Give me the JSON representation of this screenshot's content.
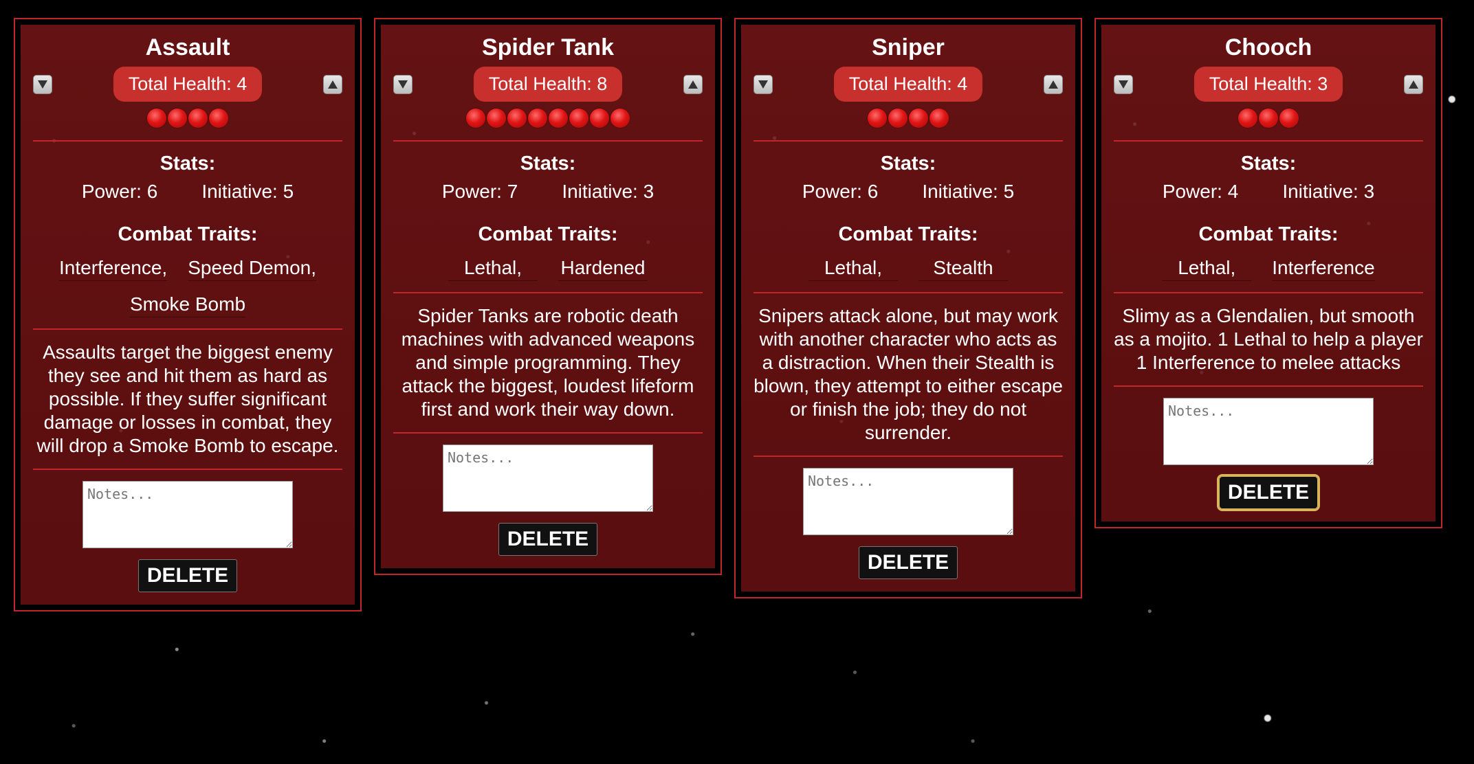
{
  "labels": {
    "health_prefix": "Total Health: ",
    "stats_heading": "Stats:",
    "power_prefix": "Power: ",
    "initiative_prefix": "Initiative: ",
    "traits_heading": "Combat Traits:",
    "notes_placeholder": "Notes...",
    "delete_label": "DELETE"
  },
  "icons": {
    "decrease": "triangle-down-icon",
    "increase": "triangle-up-icon",
    "health_pip": "red-orb-icon"
  },
  "colors": {
    "card_bg": "#5e0f10",
    "card_border": "#c0262a",
    "health_pill": "#c8302e",
    "pip": "#e01515",
    "focus_outline": "#d9b45a"
  },
  "cards": [
    {
      "name": "Assault",
      "total_health": 4,
      "health_text": "Total Health: 4",
      "power_text": "Power: 6",
      "initiative_text": "Initiative: 5",
      "traits": [
        "Interference,",
        "Speed Demon,",
        "Smoke Bomb"
      ],
      "description": "Assaults target the biggest enemy they see and hit them as hard as possible. If they suffer significant damage or losses in combat, they will drop a Smoke Bomb to escape.",
      "notes_value": "",
      "delete_focused": false
    },
    {
      "name": "Spider Tank",
      "total_health": 8,
      "health_text": "Total Health: 8",
      "power_text": "Power: 7",
      "initiative_text": "Initiative: 3",
      "traits": [
        "Lethal,",
        "Hardened"
      ],
      "description": "Spider Tanks are robotic death machines with advanced weapons and simple programming. They attack the biggest, loudest lifeform first and work their way down.",
      "notes_value": "",
      "delete_focused": false
    },
    {
      "name": "Sniper",
      "total_health": 4,
      "health_text": "Total Health: 4",
      "power_text": "Power: 6",
      "initiative_text": "Initiative: 5",
      "traits": [
        "Lethal,",
        "Stealth"
      ],
      "description": "Snipers attack alone, but may work with another character who acts as a distraction. When their Stealth is blown, they attempt to either escape or finish the job; they do not surrender.",
      "notes_value": "",
      "delete_focused": false
    },
    {
      "name": "Chooch",
      "total_health": 3,
      "health_text": "Total Health: 3",
      "power_text": "Power: 4",
      "initiative_text": "Initiative: 3",
      "traits": [
        "Lethal,",
        "Interference"
      ],
      "description": "Slimy as a Glendalien, but smooth as a mojito. 1 Lethal to help a player 1 Interference to melee attacks",
      "notes_value": "",
      "delete_focused": true
    }
  ]
}
